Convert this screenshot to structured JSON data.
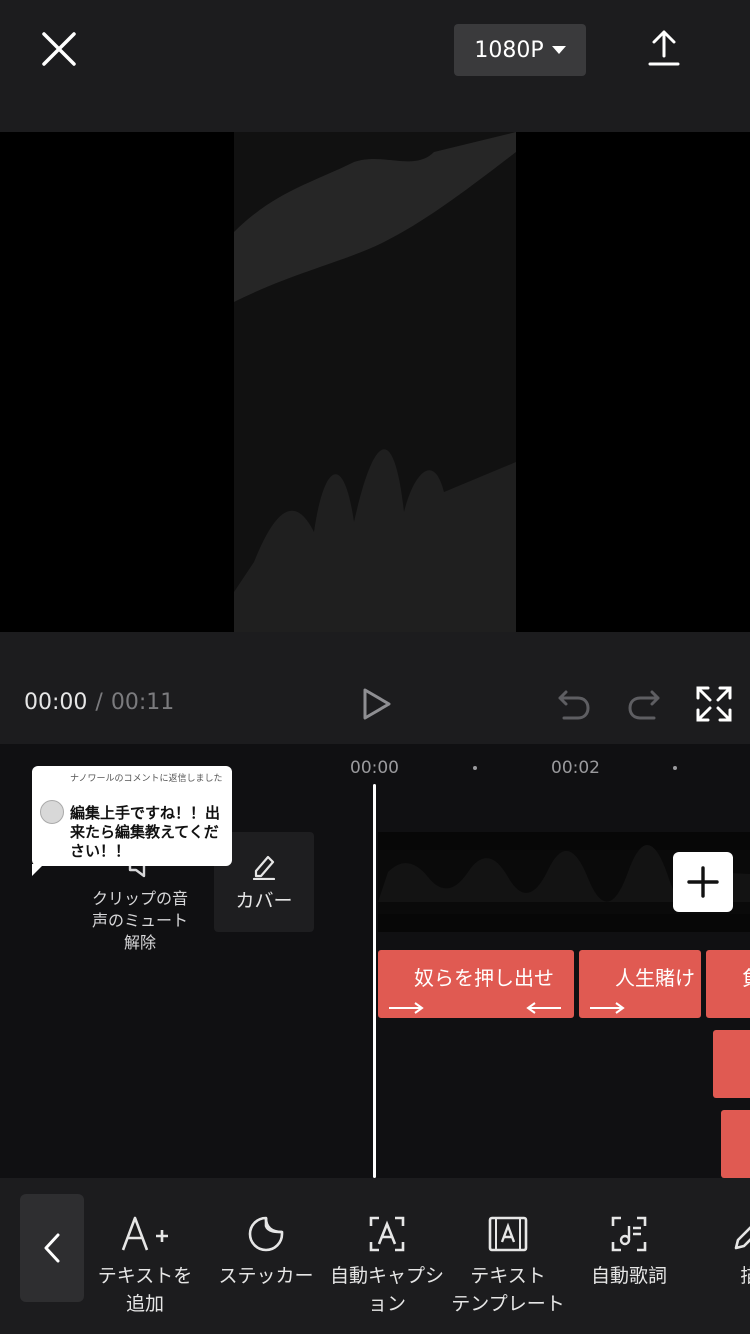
{
  "topbar": {
    "resolution": "1080P"
  },
  "controls": {
    "current_time": "00:00",
    "separator": "/",
    "total_time": "00:11"
  },
  "ruler": {
    "labels": [
      "00:00",
      "00:02"
    ]
  },
  "tools_left": {
    "mute_label": "クリップの音\n声のミュート\n解除",
    "cover_label": "カバー"
  },
  "comment": {
    "reply_text": "ナノワールのコメントに返信しました",
    "message": "編集上手ですね！！出来たら編集教えてください！！"
  },
  "text_clips": [
    {
      "label": "奴らを押し出せ"
    },
    {
      "label": "人生賭け"
    },
    {
      "label": "負"
    }
  ],
  "bottom_tools": [
    {
      "icon": "text-add-icon",
      "label": "テキストを\n追加"
    },
    {
      "icon": "sticker-icon",
      "label": "ステッカー"
    },
    {
      "icon": "auto-caption-icon",
      "label": "自動キャプシ\nョン"
    },
    {
      "icon": "text-template-icon",
      "label": "テキスト\nテンプレート"
    },
    {
      "icon": "auto-lyrics-icon",
      "label": "自動歌詞"
    },
    {
      "icon": "draw-icon",
      "label": "描"
    }
  ],
  "colors": {
    "accent_clip": "#e05a52",
    "panel": "#1c1c1e",
    "background": "#101012"
  }
}
